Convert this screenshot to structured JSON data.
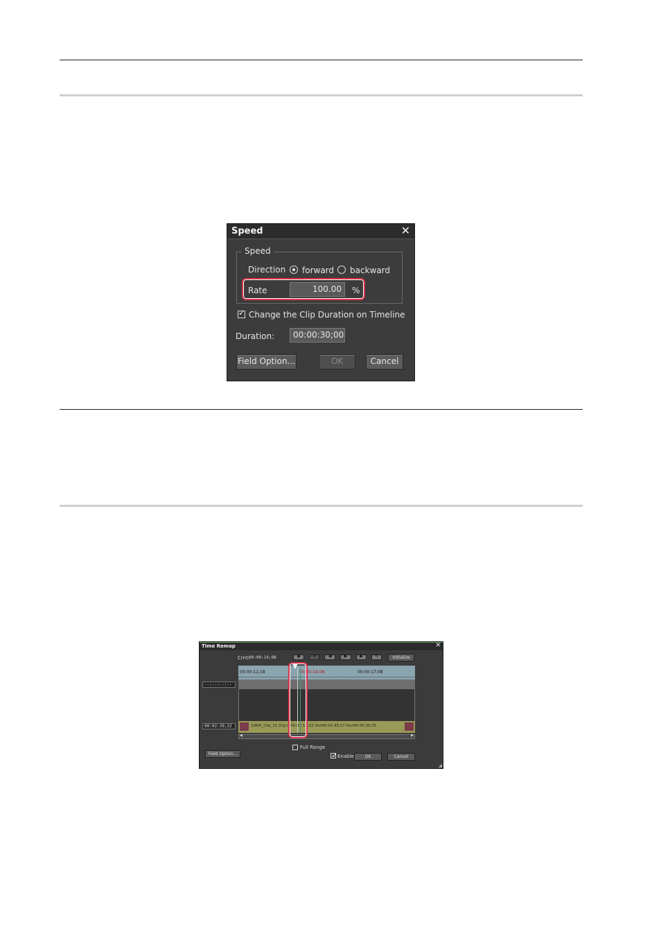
{
  "speed_dialog": {
    "title": "Speed",
    "group_label": "Speed",
    "direction_label": "Direction",
    "radio_forward": "forward",
    "radio_backward": "backward",
    "rate_label": "Rate",
    "rate_value": "100.00",
    "rate_unit": "%",
    "checkbox_label": "Change the Clip Duration on Timeline",
    "duration_label": "Duration:",
    "duration_value": "00:00:30;00",
    "field_option_button": "Field Option...",
    "ok_button": "OK",
    "cancel_button": "Cancel",
    "close_glyph": "✕"
  },
  "time_remap_dialog": {
    "title": "Time Remap",
    "close_glyph": "✕",
    "crnt_label": "Crnt:",
    "crnt_value": "00:00:14;08",
    "initialize_button": "Initialize",
    "ruler_left": "00:00:11;18",
    "ruler_mid": "00:00:14;08",
    "ruler_right": "00:00:17;08",
    "track_timecode": "--:--:--:--",
    "clip_timecode": "00:02:39;22",
    "clip_text": "1080i_Clip_11 Org:In00:02:15;22 Out00:02:45;17 Dur00:00:30;25",
    "full_range_label": "Full Range",
    "enable_label": "Enable",
    "field_option_button": "Field Option...",
    "ok_button": "OK",
    "cancel_button": "Cancel"
  },
  "colors": {
    "dialog_bg": "#3c3c3c",
    "highlight": "#d8324a",
    "ruler": "#8ba5b0",
    "clip": "#9a9a58"
  }
}
